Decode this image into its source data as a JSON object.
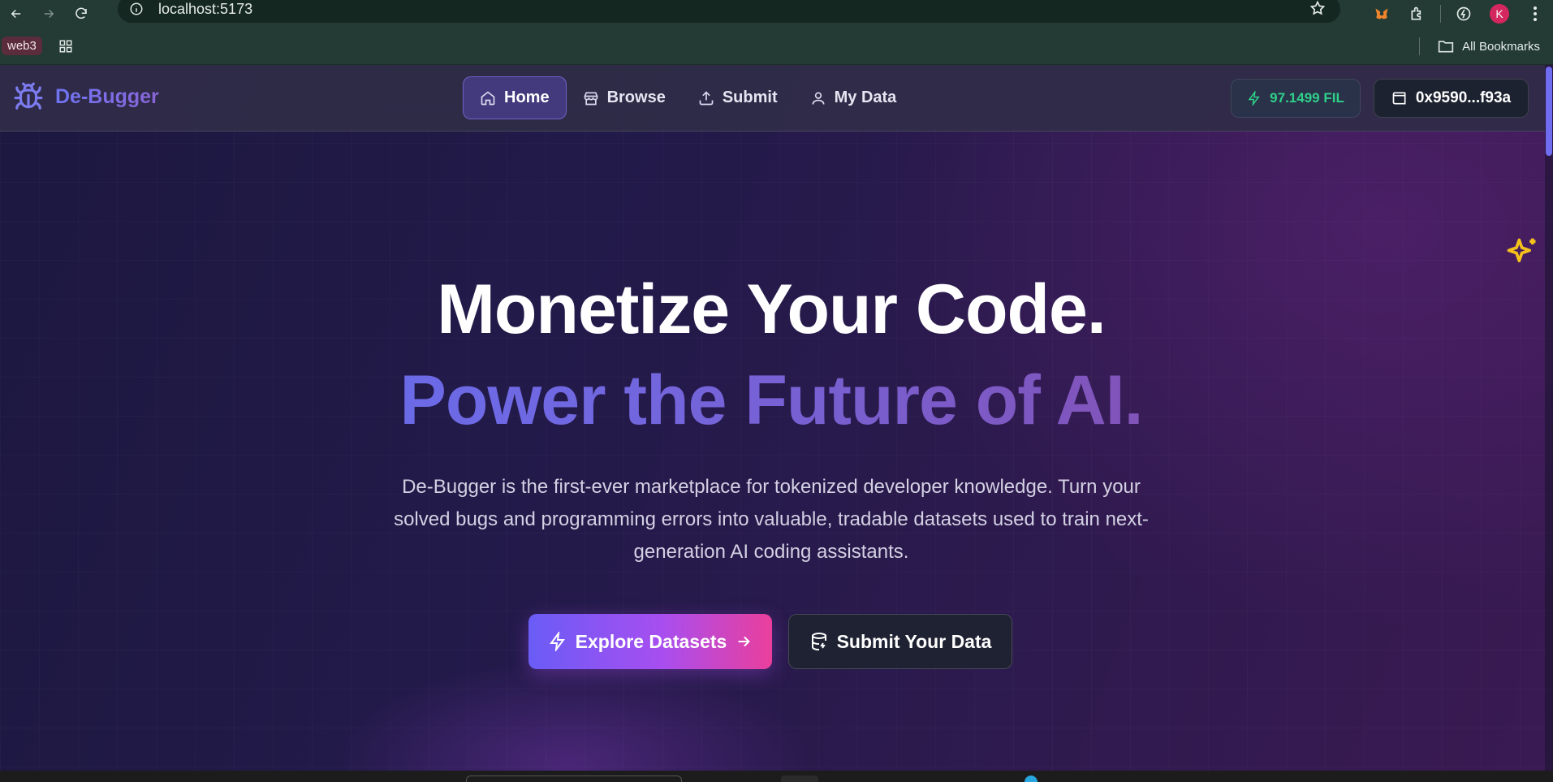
{
  "browser": {
    "url": "localhost:5173",
    "bookmark_chip": "web3",
    "all_bookmarks": "All Bookmarks",
    "profile_initial": "K"
  },
  "header": {
    "logo_text": "De-Bugger",
    "nav": [
      {
        "label": "Home",
        "icon": "home-icon",
        "active": true
      },
      {
        "label": "Browse",
        "icon": "store-icon",
        "active": false
      },
      {
        "label": "Submit",
        "icon": "upload-icon",
        "active": false
      },
      {
        "label": "My Data",
        "icon": "user-icon",
        "active": false
      }
    ],
    "fil_balance": "97.1499 FIL",
    "wallet_address": "0x9590...f93a"
  },
  "hero": {
    "title_line1": "Monetize Your Code.",
    "title_line2": "Power the Future of AI.",
    "description": "De-Bugger is the first-ever marketplace for tokenized developer knowledge. Turn your solved bugs and programming errors into valuable, tradable datasets used to train next-generation AI coding assistants.",
    "primary_cta": "Explore Datasets",
    "secondary_cta": "Submit Your Data"
  },
  "colors": {
    "accent": "#6f74f2",
    "fil_green": "#2fd08a",
    "sparkle": "#f5c21b",
    "gradient_pink": "#ea3f9c"
  }
}
